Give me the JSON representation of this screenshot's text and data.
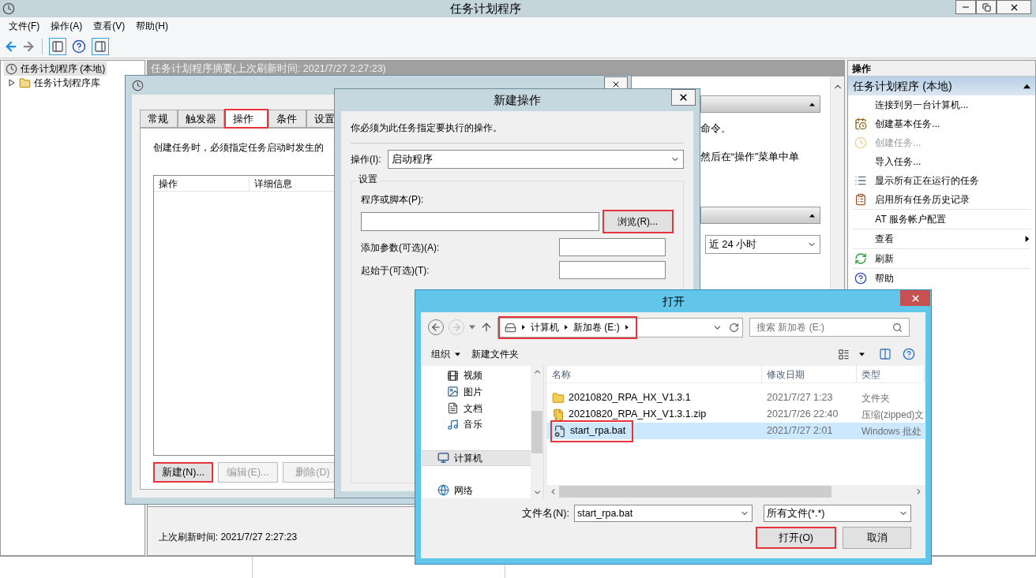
{
  "window": {
    "title": "任务计划程序"
  },
  "menu": [
    {
      "label": "文件(F)"
    },
    {
      "label": "操作(A)"
    },
    {
      "label": "查看(V)"
    },
    {
      "label": "帮助(H)"
    }
  ],
  "tree": [
    {
      "label": "任务计划程序 (本地)",
      "selected": true,
      "children": [
        {
          "label": "任务计划程序库",
          "selected": false,
          "expanded": false
        }
      ]
    }
  ],
  "summary": {
    "header": "任务计划程序摘要(上次刷新时间: 2021/7/27 2:27:23)",
    "text_fragments": [
      "命令。",
      "然后在“操作”菜单中单"
    ],
    "range": "近 24 小时",
    "footer": "上次刷新时间: 2021/7/27 2:27:23"
  },
  "actions": {
    "header": "操作",
    "section": {
      "title": "任务计划程序 (本地)",
      "expanded": true
    },
    "groups": [
      [
        {
          "label": "连接到另一台计算机...",
          "kind": "plain",
          "disabled": false,
          "submenu": false
        },
        {
          "label": "创建基本任务...",
          "kind": "wizard",
          "disabled": false,
          "submenu": false
        },
        {
          "label": "创建任务...",
          "kind": "create",
          "disabled": true,
          "submenu": false
        },
        {
          "label": "导入任务...",
          "kind": "plain",
          "disabled": false,
          "submenu": false
        },
        {
          "label": "显示所有正在运行的任务",
          "kind": "running",
          "disabled": false,
          "submenu": false
        },
        {
          "label": "启用所有任务历史记录",
          "kind": "history",
          "disabled": false,
          "submenu": false
        }
      ],
      [
        {
          "label": "AT 服务帐户配置",
          "kind": "plain",
          "disabled": false,
          "submenu": false
        }
      ],
      [
        {
          "label": "查看",
          "kind": "plain",
          "disabled": false,
          "submenu": true
        }
      ],
      [
        {
          "label": "刷新",
          "kind": "refresh",
          "disabled": false,
          "submenu": false
        }
      ],
      [
        {
          "label": "帮助",
          "kind": "help",
          "disabled": false,
          "submenu": false
        }
      ]
    ]
  },
  "create_task": {
    "tabs": [
      {
        "label": "常规",
        "selected": false,
        "highlighted": false
      },
      {
        "label": "触发器",
        "selected": false,
        "highlighted": false
      },
      {
        "label": "操作",
        "selected": true,
        "highlighted": true
      },
      {
        "label": "条件",
        "selected": false,
        "highlighted": false
      },
      {
        "label": "设置",
        "selected": false,
        "highlighted": false
      }
    ],
    "description": "创建任务时，必须指定任务启动时发生的",
    "columns": [
      "操作",
      "详细信息"
    ],
    "buttons": [
      {
        "label": "新建(N)...",
        "disabled": false,
        "highlighted": true
      },
      {
        "label": "编辑(E)...",
        "disabled": true,
        "highlighted": false
      },
      {
        "label": "删除(D)",
        "disabled": true,
        "highlighted": false
      }
    ]
  },
  "new_action": {
    "title": "新建操作",
    "instruction": "你必须为此任务指定要执行的操作。",
    "action_label": "操作(I):",
    "action_value": "启动程序",
    "group_title": "设置",
    "program_label": "程序或脚本(P):",
    "browse_button": {
      "label": "浏览(R)...",
      "highlighted": true
    },
    "args_label": "添加参数(可选)(A):",
    "start_in_label": "起始于(可选)(T):"
  },
  "open_dialog": {
    "title": "打开",
    "path": {
      "segments": [
        "计算机",
        "新加卷 (E:)"
      ],
      "highlighted": true
    },
    "search_placeholder": "搜索 新加卷 (E:)",
    "toolbar": [
      "组织",
      "新建文件夹"
    ],
    "nav": [
      {
        "label": "视频",
        "kind": "video",
        "selected": false
      },
      {
        "label": "图片",
        "kind": "picture",
        "selected": false
      },
      {
        "label": "文档",
        "kind": "document",
        "selected": false
      },
      {
        "label": "音乐",
        "kind": "music",
        "selected": false
      },
      {
        "label": "计算机",
        "kind": "computer",
        "selected": true
      },
      {
        "label": "网络",
        "kind": "network",
        "selected": false
      }
    ],
    "columns": [
      "名称",
      "修改日期",
      "类型"
    ],
    "files": [
      {
        "name": "20210820_RPA_HX_V1.3.1",
        "date": "2021/7/27 1:23",
        "type": "文件夹",
        "kind": "folder",
        "selected": false,
        "highlighted": false
      },
      {
        "name": "20210820_RPA_HX_V1.3.1.zip",
        "date": "2021/7/26 22:40",
        "type": "压缩(zipped)文",
        "kind": "zip",
        "selected": false,
        "highlighted": false
      },
      {
        "name": "start_rpa.bat",
        "date": "2021/7/27 2:01",
        "type": "Windows 批处",
        "kind": "batch",
        "selected": true,
        "highlighted": true
      }
    ],
    "filename_label": "文件名(N):",
    "filename": "start_rpa.bat",
    "filter": "所有文件(*.*)",
    "buttons": [
      {
        "label": "打开(O)",
        "highlighted": true
      },
      {
        "label": "取消",
        "highlighted": false
      }
    ]
  }
}
